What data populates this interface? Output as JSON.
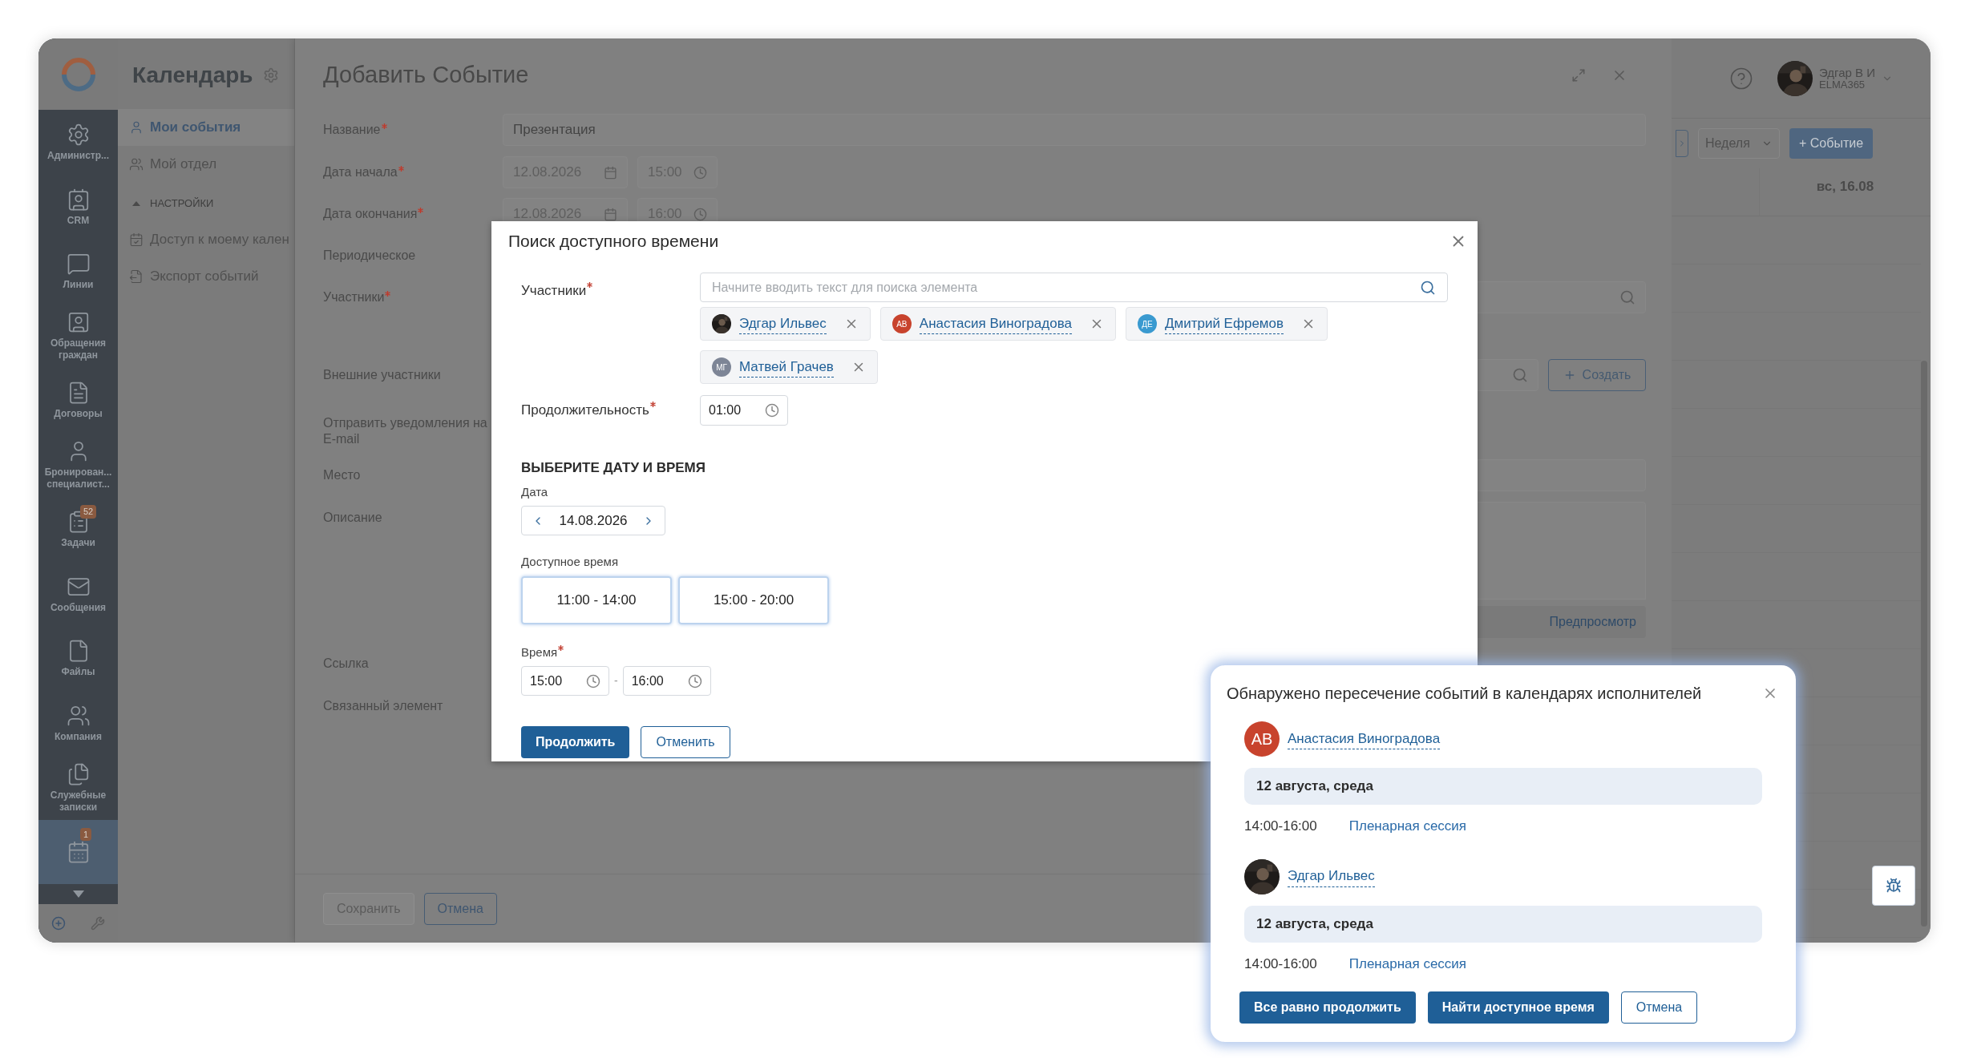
{
  "sidebar": {
    "items": [
      {
        "label": "Администр...",
        "selected": false
      },
      {
        "label": "CRM",
        "selected": false
      },
      {
        "label": "Линии",
        "selected": false
      },
      {
        "label": "Обращения граждан",
        "selected": false
      },
      {
        "label": "Договоры",
        "selected": false
      },
      {
        "label": "Бронирован... специалист...",
        "selected": false
      },
      {
        "label": "Задачи",
        "badge": "52",
        "selected": false
      },
      {
        "label": "Сообщения",
        "selected": false
      },
      {
        "label": "Файлы",
        "selected": false
      },
      {
        "label": "Компания",
        "selected": false
      },
      {
        "label": "Служебные записки",
        "selected": false
      },
      {
        "badge": "1",
        "selected": true
      }
    ]
  },
  "nav": {
    "title": "Календарь",
    "items": [
      {
        "label": "Мои события",
        "selected": true
      },
      {
        "label": "Мой отдел",
        "selected": false
      }
    ],
    "section": {
      "title": "НАСТРОЙКИ",
      "expanded": true,
      "items": [
        "Доступ к моему кален",
        "Экспорт событий"
      ]
    }
  },
  "form": {
    "title": "Добавить Событие",
    "fields": [
      {
        "label": "Название",
        "required": true,
        "kind": "text",
        "value": "Презентация"
      },
      {
        "label": "Дата начала",
        "required": true,
        "kind": "datetime",
        "date": "12.08.2026",
        "time": "15:00"
      },
      {
        "label": "Дата окончания",
        "required": true,
        "kind": "datetime",
        "date": "12.08.2026",
        "time": "16:00"
      },
      {
        "label": "Периодическое",
        "required": false,
        "kind": "plain"
      },
      {
        "label": "Участники",
        "required": true,
        "kind": "participants"
      },
      {
        "label": "Внешние участники",
        "required": false,
        "kind": "external",
        "action": "Создать"
      },
      {
        "label": "Отправить уведомления на E-mail",
        "required": false,
        "kind": "plain"
      },
      {
        "label": "Место",
        "required": false,
        "kind": "text"
      },
      {
        "label": "Описание",
        "required": false,
        "kind": "textarea",
        "preview": "Предпросмотр"
      },
      {
        "label": "Ссылка",
        "required": false,
        "kind": "plain"
      },
      {
        "label": "Связанный элемент",
        "required": false,
        "kind": "plain"
      }
    ],
    "buttons": [
      {
        "label": "Сохранить",
        "disabled": true
      },
      {
        "label": "Отмена",
        "disabled": false
      }
    ]
  },
  "user": {
    "name": "Эдгар В И",
    "org": "ELMA365"
  },
  "calendar": {
    "view": "Неделя",
    "add": "+ Событие",
    "day": "вс, 16.08"
  },
  "availability_dialog": {
    "title": "Поиск доступного времени",
    "participants": {
      "label": "Участники",
      "required": true,
      "placeholder": "Начните вводить текст для поиска элемента",
      "chips": [
        {
          "name": "Эдгар Ильвес"
        },
        {
          "name": "Анастасия Виноградова",
          "kind": "initials",
          "initials": "АВ",
          "color": "#c8432d"
        },
        {
          "name": "Дмитрий Ефремов",
          "kind": "initials",
          "initials": "ДЕ",
          "color": "#3a9ad0"
        },
        {
          "name": "Матвей Грачев",
          "kind": "initials",
          "initials": "МГ",
          "color": "#7d8596"
        }
      ]
    },
    "duration": {
      "label": "Продолжительность",
      "required": true,
      "value": "01:00"
    },
    "section": "ВЫБЕРИТЕ ДАТУ И ВРЕМЯ",
    "date": {
      "label": "Дата",
      "value": "14.08.2026"
    },
    "slots": {
      "label": "Доступное время",
      "items": [
        "11:00 - 14:00",
        "15:00 - 20:00"
      ]
    },
    "time": {
      "label": "Время",
      "required": true,
      "from": "15:00",
      "separator": "-",
      "to": "16:00"
    },
    "buttons": [
      {
        "label": "Продолжить",
        "kind": "primary"
      },
      {
        "label": "Отменить",
        "kind": "secondary"
      }
    ]
  },
  "conflict_dialog": {
    "title": "Обнаружено пересечение событий в календарях исполнителей",
    "people": [
      {
        "name": "Анастасия Виноградова",
        "kind": "initials",
        "initials": "АВ",
        "color": "#c8432d",
        "date": "12 августа, среда",
        "time": "14:00-16:00",
        "event": "Пленарная сессия"
      },
      {
        "name": "Эдгар Ильвес",
        "date": "12 августа, среда",
        "time": "14:00-16:00",
        "event": "Пленарная сессия"
      }
    ],
    "buttons": [
      {
        "label": "Все равно продолжить",
        "kind": "primary"
      },
      {
        "label": "Найти доступное время",
        "kind": "primary"
      },
      {
        "label": "Отмена",
        "kind": "secondary"
      }
    ]
  }
}
